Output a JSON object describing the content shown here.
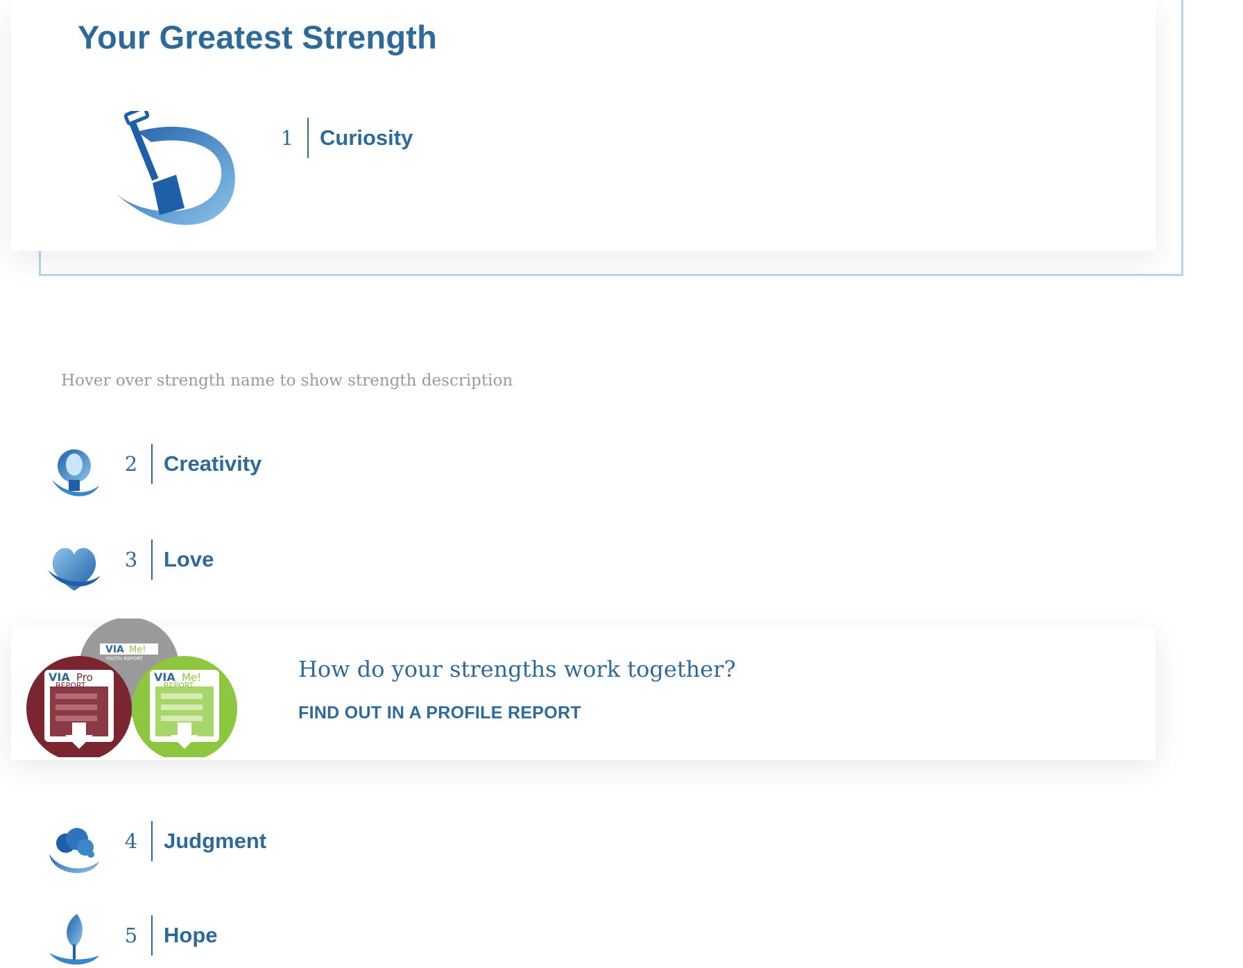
{
  "header": {
    "title": "Your Greatest Strength"
  },
  "top_strength": {
    "rank": "1",
    "name": "Curiosity",
    "icon": "curiosity-shovel-icon"
  },
  "hint": "Hover over strength name to show strength description",
  "strengths": [
    {
      "rank": "2",
      "name": "Creativity",
      "icon": "creativity-lightbulb-icon"
    },
    {
      "rank": "3",
      "name": "Love",
      "icon": "love-heart-icon"
    },
    {
      "rank": "4",
      "name": "Judgment",
      "icon": "judgment-cloud-icon"
    },
    {
      "rank": "5",
      "name": "Hope",
      "icon": "hope-sprout-icon"
    }
  ],
  "promo": {
    "question": "How do your strengths work together?",
    "link_label": "FIND OUT IN A PROFILE REPORT",
    "badges": [
      {
        "brand": "VIA",
        "title": "Pro",
        "subtitle": "REPORT",
        "color": "#7a2530"
      },
      {
        "brand": "VIA",
        "title": "Me!",
        "subtitle": "YOUTH REPORT",
        "color": "#9a9a9a"
      },
      {
        "brand": "VIA",
        "title": "Me!",
        "subtitle": "REPORT",
        "color": "#8dc63f"
      }
    ]
  },
  "colors": {
    "accent": "#2e6a99",
    "frame": "#b7d6e5",
    "hint": "#9a9a9a"
  }
}
